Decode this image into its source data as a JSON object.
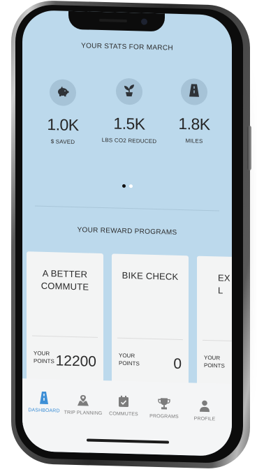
{
  "stats": {
    "title": "YOUR STATS FOR MARCH",
    "items": [
      {
        "value": "1.0K",
        "label": "$ SAVED",
        "icon": "piggy-bank-icon"
      },
      {
        "value": "1.5K",
        "label": "LBS CO2 REDUCED",
        "icon": "plant-icon"
      },
      {
        "value": "1.8K",
        "label": "MILES",
        "icon": "road-icon"
      }
    ]
  },
  "pager": {
    "active_index": 0,
    "count": 2
  },
  "rewards": {
    "title": "YOUR REWARD PROGRAMS",
    "cards": [
      {
        "title": "A BETTER COMMUTE",
        "points_label_1": "YOUR",
        "points_label_2": "POINTS",
        "points": "12200"
      },
      {
        "title": "BIKE CHECK",
        "points_label_1": "YOUR",
        "points_label_2": "POINTS",
        "points": "0"
      },
      {
        "title": "EX L",
        "points_label_1": "YOUR",
        "points_label_2": "POINTS",
        "points": ""
      }
    ]
  },
  "tabs": [
    {
      "label": "DASHBOARD",
      "icon": "road-icon",
      "active": true
    },
    {
      "label": "TRIP PLANNING",
      "icon": "map-pin-icon",
      "active": false
    },
    {
      "label": "COMMUTES",
      "icon": "calendar-check-icon",
      "active": false
    },
    {
      "label": "PROGRAMS",
      "icon": "trophy-icon",
      "active": false
    },
    {
      "label": "PROFILE",
      "icon": "person-icon",
      "active": false
    }
  ],
  "colors": {
    "screen_bg": "#bcd9ec",
    "accent": "#3d8fd6",
    "icon_circle": "#a6c3d7",
    "icon_dark": "#2f3338",
    "tab_inactive": "#7c7c7c"
  }
}
